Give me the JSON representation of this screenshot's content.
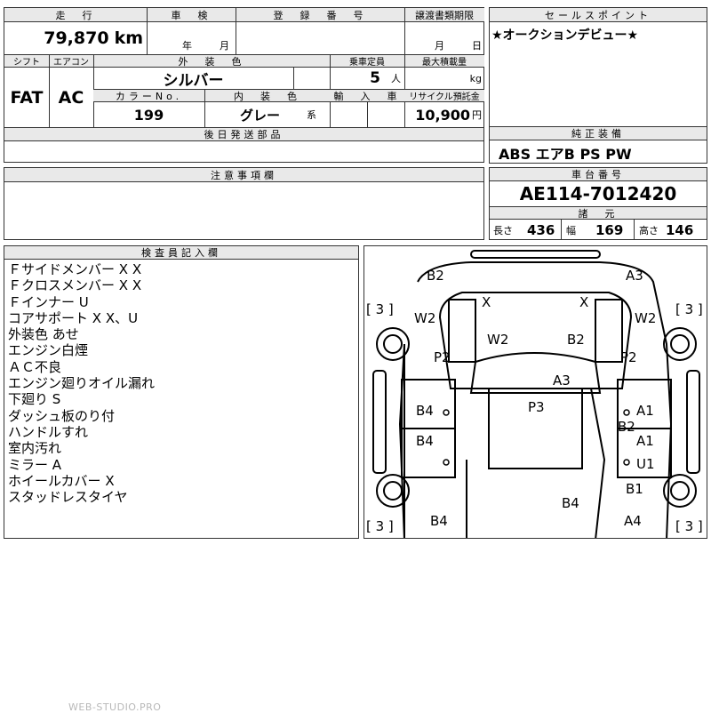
{
  "headers": {
    "mileage": "走　行",
    "inspection": "車　検",
    "registration": "登　録　番　号",
    "transfer_deadline": "譲渡書類期限",
    "sales_point": "セールスポイント",
    "shift": "シフト",
    "aircon": "エアコン",
    "exterior_color": "外　装　色",
    "capacity": "乗車定員",
    "max_load": "最大積載量",
    "color_no": "カラーNo.",
    "interior_color": "内　装　色",
    "import": "輸　入　車",
    "recycle": "リサイクル預託金",
    "later_parts": "後日発送部品",
    "genuine_equipment": "純正装備",
    "notes": "注意事項欄",
    "chassis": "車台番号",
    "specs": "諸　元",
    "inspector": "検査員記入欄"
  },
  "values": {
    "mileage": "79,870",
    "mileage_unit": "km",
    "inspection_year_unit": "年",
    "inspection_month_unit": "月",
    "deadline_month_unit": "月",
    "deadline_day_unit": "日",
    "sales_point": "★オークションデビュー★",
    "shift": "FAT",
    "aircon": "AC",
    "exterior_color": "シルバー",
    "capacity": "5",
    "capacity_unit": "人",
    "max_load_unit": "kg",
    "color_no": "199",
    "interior_color": "グレー",
    "interior_suffix": "系",
    "recycle": "10,900",
    "recycle_unit": "円",
    "genuine_equipment": "ABS エアB PS PW",
    "chassis": "AE114-7012420",
    "length_label": "長さ",
    "length": "436",
    "width_label": "幅",
    "width": "169",
    "height_label": "高さ",
    "height": "146"
  },
  "inspector_notes": [
    "Ｆサイドメンバー X X",
    "Ｆクロスメンバー X X",
    "Ｆインナー U",
    "コアサポート X X、U",
    "外装色 あせ",
    "エンジン白煙",
    "ＡＣ不良",
    "エンジン廻りオイル漏れ",
    "下廻り S",
    "ダッシュ板のり付",
    "ハンドルすれ",
    "室内汚れ",
    "ミラー A",
    "ホイールカバー X",
    "スタッドレスタイヤ"
  ],
  "diagram": {
    "tire_tread": "[ 3 ]",
    "marks": [
      "B2",
      "A3",
      "X",
      "X",
      "W2",
      "W2",
      "W2",
      "B2",
      "P2",
      "P2",
      "A3",
      "P3",
      "B4",
      "A1",
      "B2",
      "B4",
      "A1",
      "U1",
      "B1",
      "B4",
      "B4",
      "A4"
    ]
  },
  "watermark": "WEB-STUDIO.PRO"
}
